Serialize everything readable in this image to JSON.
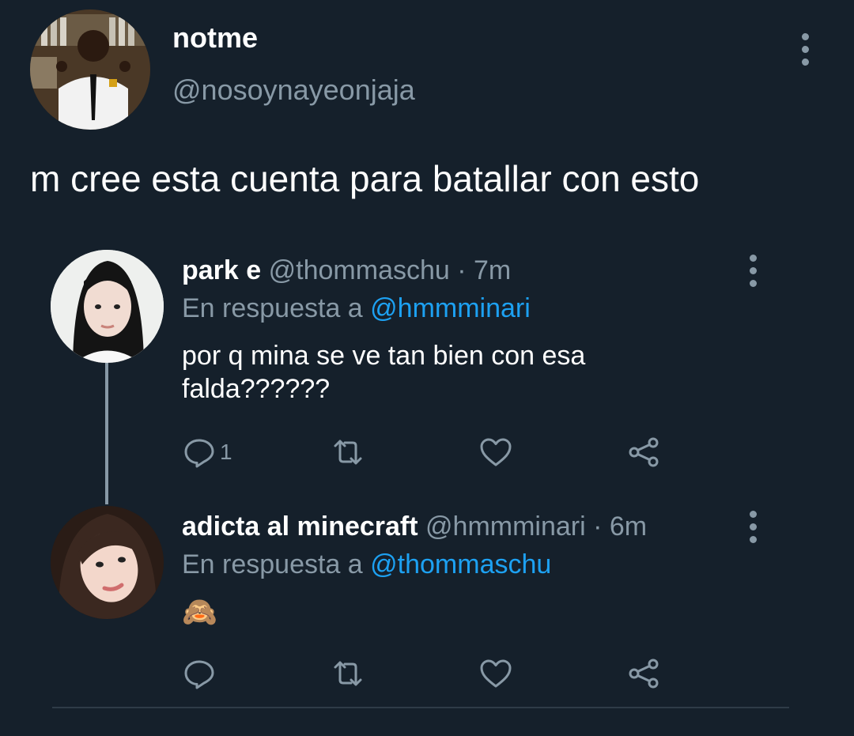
{
  "original_tweet": {
    "display_name": "notme",
    "handle": "@nosoynayeonjaja",
    "text": "m cree esta cuenta para batallar con esto",
    "avatar_icon": "avatar-photo-icon"
  },
  "replies": [
    {
      "display_name": "park e",
      "handle": "@thommaschu",
      "time": "· 7m",
      "reply_prefix": "En respuesta a",
      "reply_to": "@hmmminari",
      "text_line1": "por q mina se ve tan bien con esa",
      "text_line2": "falda??????",
      "reply_count": "1"
    },
    {
      "display_name": "adicta al minecraft",
      "handle": "@hmmminari",
      "time": "· 6m",
      "reply_prefix": "En respuesta a",
      "reply_to": "@thommaschu",
      "text": "🙈",
      "reply_count": ""
    }
  ],
  "colors": {
    "background": "#15202b",
    "secondary_text": "#8899a6",
    "link": "#1da1f2",
    "thread_line": "#8899a6"
  }
}
